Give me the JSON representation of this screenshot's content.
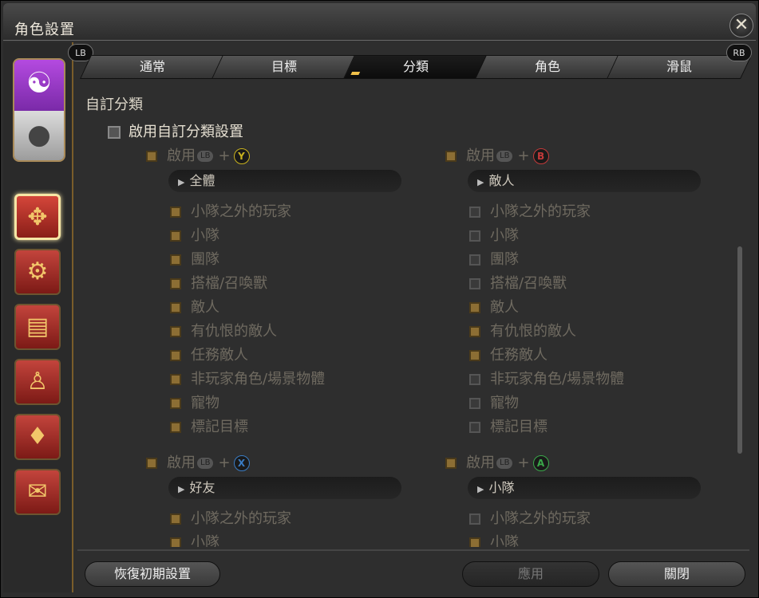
{
  "window": {
    "title": "角色設置",
    "close_glyph": "✕"
  },
  "tabs": {
    "lb": "LB",
    "rb": "RB",
    "items": [
      {
        "label": "通常"
      },
      {
        "label": "目標"
      },
      {
        "label": "分類",
        "active": true
      },
      {
        "label": "角色"
      },
      {
        "label": "滑鼠"
      }
    ]
  },
  "section_title": "自訂分類",
  "master": {
    "label": "啟用自訂分類設置"
  },
  "groups": [
    {
      "label": "啟用",
      "button": "Y",
      "button_color": "#c9b21e",
      "dropdown": "全體",
      "items": [
        {
          "label": "小隊之外的玩家",
          "checked": true
        },
        {
          "label": "小隊",
          "checked": true
        },
        {
          "label": "團隊",
          "checked": true
        },
        {
          "label": "搭檔/召喚獸",
          "checked": true
        },
        {
          "label": "敵人",
          "checked": true
        },
        {
          "label": "有仇恨的敵人",
          "checked": true
        },
        {
          "label": "任務敵人",
          "checked": true
        },
        {
          "label": "非玩家角色/場景物體",
          "checked": true
        },
        {
          "label": "寵物",
          "checked": true
        },
        {
          "label": "標記目標",
          "checked": true
        }
      ]
    },
    {
      "label": "啟用",
      "button": "B",
      "button_color": "#c33a3a",
      "dropdown": "敵人",
      "items": [
        {
          "label": "小隊之外的玩家",
          "checked": false
        },
        {
          "label": "小隊",
          "checked": false
        },
        {
          "label": "團隊",
          "checked": false
        },
        {
          "label": "搭檔/召喚獸",
          "checked": false
        },
        {
          "label": "敵人",
          "checked": true
        },
        {
          "label": "有仇恨的敵人",
          "checked": true
        },
        {
          "label": "任務敵人",
          "checked": true
        },
        {
          "label": "非玩家角色/場景物體",
          "checked": false
        },
        {
          "label": "寵物",
          "checked": false
        },
        {
          "label": "標記目標",
          "checked": false
        }
      ]
    },
    {
      "label": "啟用",
      "button": "X",
      "button_color": "#3a7cc3",
      "dropdown": "好友",
      "items": [
        {
          "label": "小隊之外的玩家",
          "checked": true
        },
        {
          "label": "小隊",
          "checked": true
        }
      ]
    },
    {
      "label": "啟用",
      "button": "A",
      "button_color": "#3aa84a",
      "dropdown": "小隊",
      "items": [
        {
          "label": "小隊之外的玩家",
          "checked": false
        },
        {
          "label": "小隊",
          "checked": true
        }
      ]
    }
  ],
  "lb_pill": "LB",
  "plus": "+",
  "footer": {
    "reset": "恢復初期設置",
    "apply": "應用",
    "close": "關閉"
  },
  "icons": {
    "gamepad": "🎮",
    "mouse": "🖱"
  }
}
